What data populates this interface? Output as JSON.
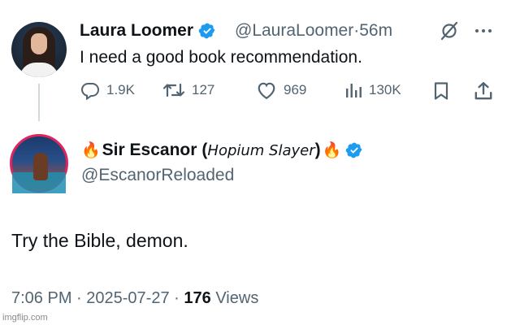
{
  "original_tweet": {
    "author_name": "Laura Loomer",
    "handle": "@LauraLoomer",
    "separator": "·",
    "time_ago": "56m",
    "text": "I need a good book recommendation.",
    "actions": {
      "replies": "1.9K",
      "reposts": "127",
      "likes": "969",
      "views": "130K"
    }
  },
  "reply_tweet": {
    "author_name": "Sir Escanor",
    "author_paren_open": "(",
    "author_italic": "Hopium Slayer",
    "author_paren_close": ")",
    "name_emoji": "🔥",
    "handle": "@EscanorReloaded",
    "text": "Try the Bible, demon.",
    "time": "7:06 PM",
    "separator": "·",
    "date": "2025-07-27",
    "separator2": "·",
    "views_count": "176",
    "views_label": "Views"
  },
  "colors": {
    "verified": "#1d9bf0",
    "muted": "#536471",
    "fire": "#f4511e",
    "avatar_ring": "#e0245e"
  },
  "watermark": "imgflip.com"
}
